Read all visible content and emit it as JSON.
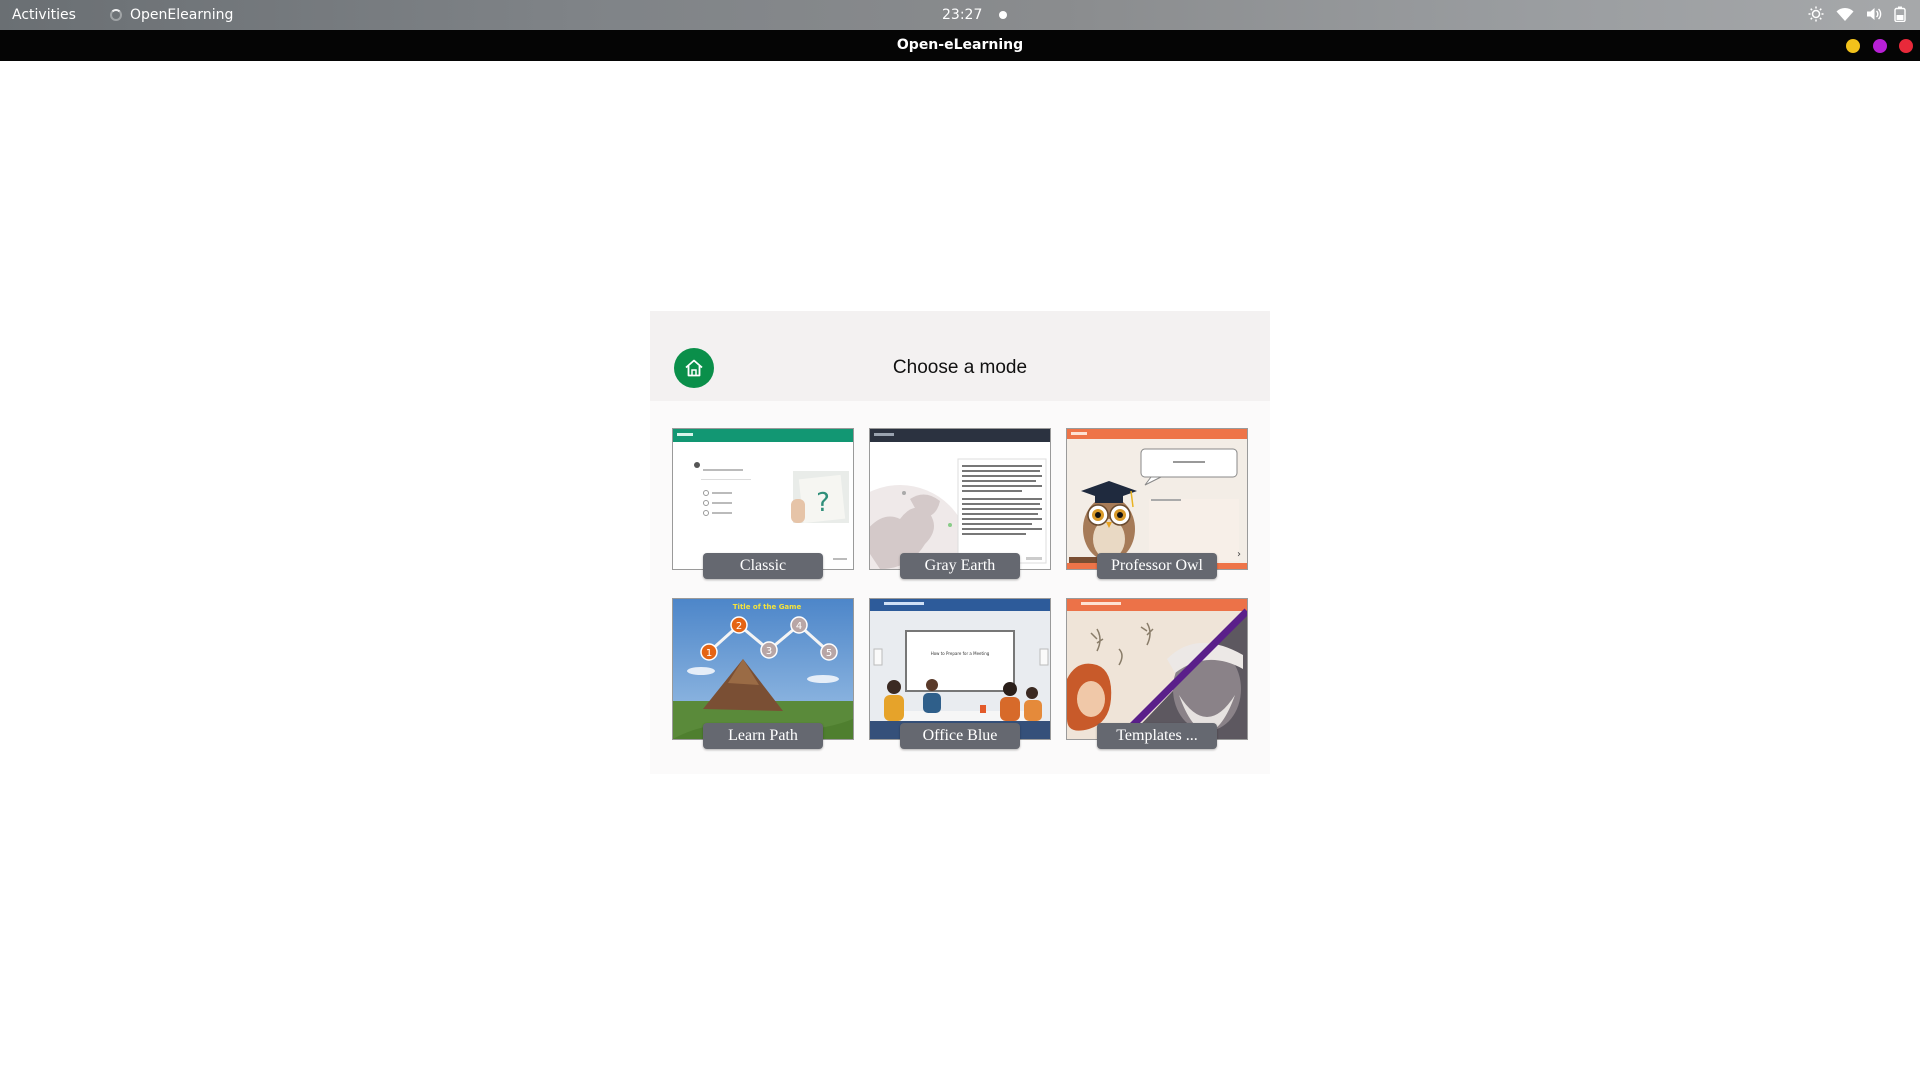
{
  "topbar": {
    "activities": "Activities",
    "app_name": "OpenElearning",
    "clock": "23:27",
    "icons": [
      "brightness-icon",
      "wifi-icon",
      "volume-icon",
      "battery-icon"
    ]
  },
  "window": {
    "title": "Open-eLearning",
    "buttons": {
      "minimize_color": "#f2c21b",
      "maximize_color": "#b820d6",
      "close_color": "#e8293a"
    }
  },
  "dialog": {
    "title": "Choose a mode",
    "home_icon": "home-icon",
    "accent": "#0a8f4a",
    "modes": [
      {
        "label": "Classic"
      },
      {
        "label": "Gray Earth"
      },
      {
        "label": "Professor Owl"
      },
      {
        "label": "Learn Path"
      },
      {
        "label": "Office Blue"
      },
      {
        "label": "Templates ..."
      }
    ]
  },
  "thumbnails": {
    "learn_path_title": "Title of the Game",
    "learn_path_steps": [
      "1",
      "2",
      "3",
      "4",
      "5"
    ],
    "office_blue_slide": "How to Prepare for a Meeting"
  }
}
